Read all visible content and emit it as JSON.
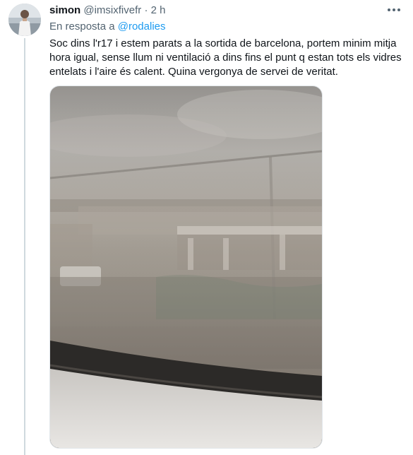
{
  "tweet": {
    "display_name": "simon",
    "handle": "@imsixfivefr",
    "separator": "·",
    "time": "2 h",
    "reply_prefix": "En resposta a",
    "reply_mention": "@rodalies",
    "text": "Soc dins l'r17 i estem parats a la sortida de barcelona, portem minim mitja hora igual, sense llum ni ventilació a dins fins el punt q estan tots els vidres entelats i l'aire és calent. Quina vergonya de servei de veritat."
  },
  "icons": {
    "more": "more-horizontal-icon"
  },
  "colors": {
    "text_primary": "#0f1419",
    "text_secondary": "#536471",
    "link": "#1d9bf0",
    "thread_line": "#cfd9de"
  }
}
